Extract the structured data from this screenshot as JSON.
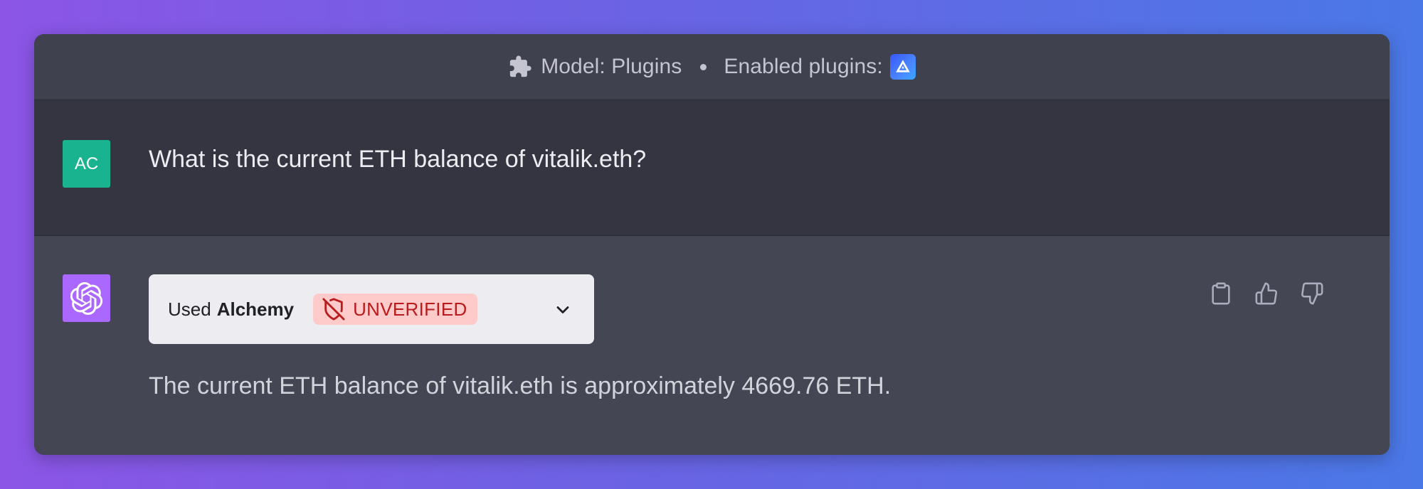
{
  "topbar": {
    "model_label": "Model: Plugins",
    "enabled_plugins_label": "Enabled plugins:",
    "plugin_icon_name": "alchemy-logo-icon",
    "accent": "#3f5ff7"
  },
  "conversation": {
    "user": {
      "avatar_initials": "AC",
      "avatar_color": "#19b48f",
      "message": "What is the current ETH balance of vitalik.eth?"
    },
    "assistant": {
      "avatar_color": "#ab68ff",
      "plugin_use": {
        "used_label": "Used",
        "plugin_name": "Alchemy",
        "status_badge": "UNVERIFIED",
        "status_color": "#b91c1c",
        "status_bg": "#fecaca"
      },
      "message": "The current ETH balance of vitalik.eth is approximately 4669.76 ETH.",
      "actions": [
        "copy-icon",
        "thumbs-up-icon",
        "thumbs-down-icon"
      ]
    }
  }
}
